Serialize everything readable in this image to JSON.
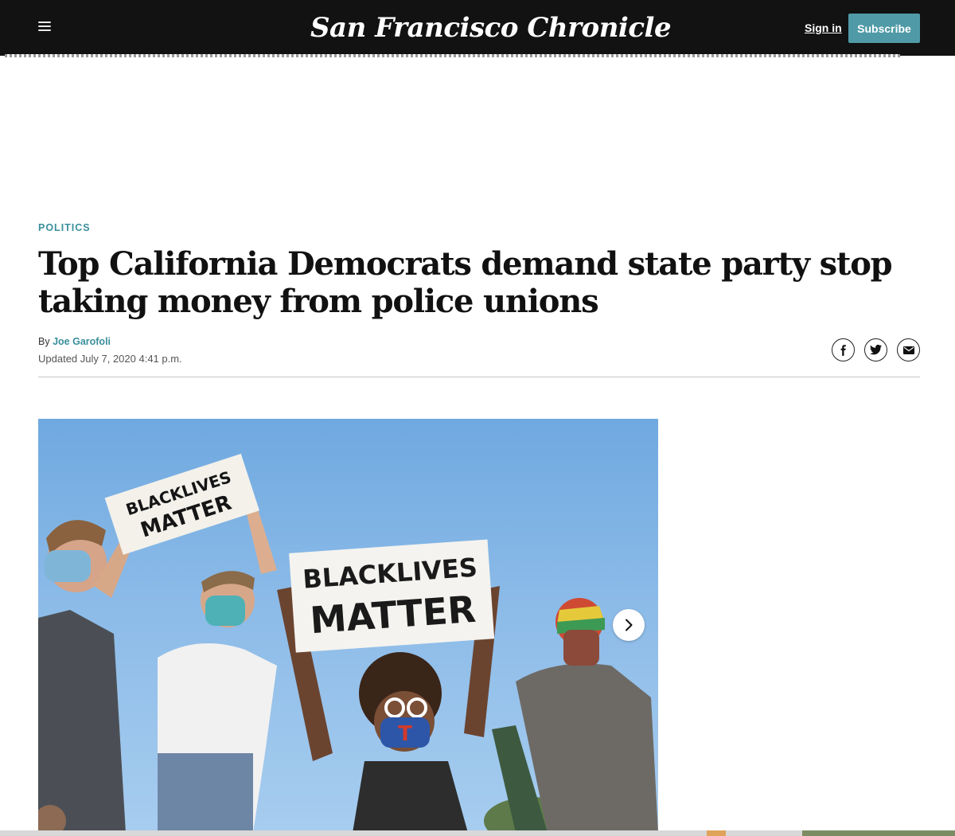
{
  "header": {
    "masthead": "San Francisco Chronicle",
    "sign_in": "Sign in",
    "subscribe": "Subscribe",
    "bar_color": "#121212",
    "accent_color": "#4f9aa6"
  },
  "article": {
    "section": "POLITICS",
    "headline": "Top California Democrats demand state party stop taking money from police unions",
    "by_label": "By",
    "author": "Joe Garofoli",
    "updated": "Updated July 7, 2020 4:41 p.m."
  },
  "share": {
    "icons": [
      "facebook-icon",
      "twitter-icon",
      "email-icon"
    ]
  },
  "photo": {
    "sign_left_line1": "BLACKLIVES",
    "sign_left_line2": "MATTER",
    "sign_center_line1": "BLACKLIVES",
    "sign_center_line2": "MATTER",
    "mask_letter": "T",
    "next_icon": "chevron-right-icon"
  }
}
